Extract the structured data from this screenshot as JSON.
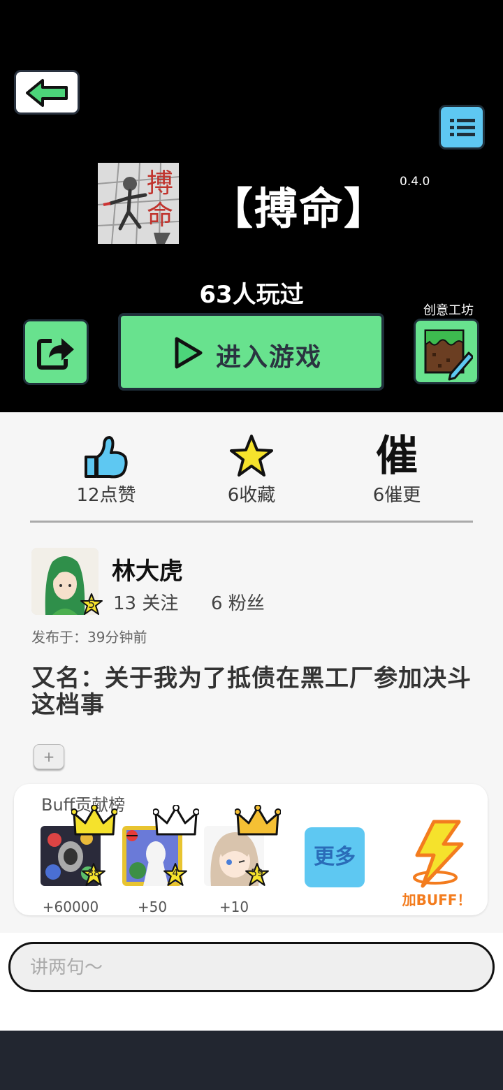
{
  "header": {
    "game_title": "【搏命】",
    "version": "0.4.0",
    "played_count": "63人玩过",
    "play_label": "进入游戏",
    "workshop_label": "创意工坊",
    "cover_text": "搏命"
  },
  "stats": {
    "likes": "12点赞",
    "favorites": "6收藏",
    "urge_icon": "催",
    "urges": "6催更"
  },
  "author": {
    "name": "林大虎",
    "level": "5",
    "follow": "13 关注",
    "fans": "6 粉丝"
  },
  "post": {
    "published": "发布于：39分钟前",
    "description": "又名：关于我为了抵债在黑工厂参加决斗这档事",
    "add_label": "+"
  },
  "buff": {
    "title": "Buff贡献榜",
    "contributors": [
      {
        "level": "88",
        "value": "+60000"
      },
      {
        "level": "4",
        "value": "+50"
      },
      {
        "level": "59",
        "value": "+10"
      }
    ],
    "more_label": "更多",
    "add_label": "加BUFF！"
  },
  "comment": {
    "placeholder": "讲两句～"
  },
  "colors": {
    "green": "#68e28e",
    "blue": "#5ec8f2",
    "yellow": "#f5e22c",
    "orange": "#f37c1e"
  },
  "icons": [
    "back-arrow-icon",
    "menu-list-icon",
    "share-icon",
    "play-icon",
    "workshop-icon",
    "thumb-up-icon",
    "star-icon",
    "crown-icon",
    "lightning-icon"
  ]
}
